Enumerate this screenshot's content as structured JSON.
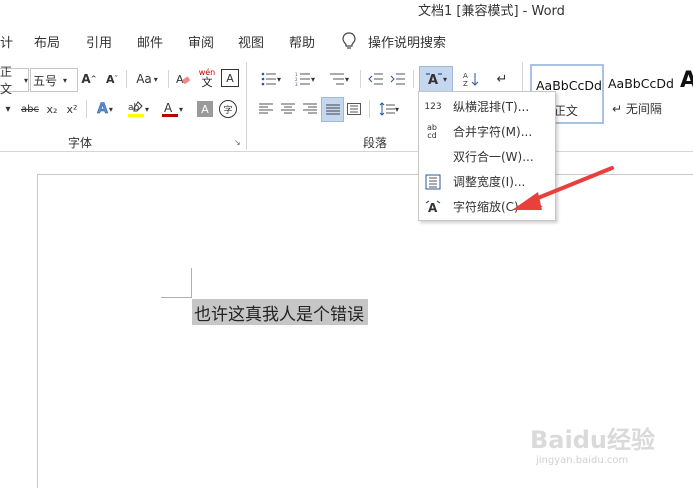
{
  "window": {
    "title": "文档1 [兼容模式]  -  Word"
  },
  "menu": {
    "items": [
      "计",
      "布局",
      "引用",
      "邮件",
      "审阅",
      "视图",
      "帮助"
    ],
    "tell_me": "操作说明搜索"
  },
  "font": {
    "name_partial": "正文",
    "size": "五号",
    "case_label": "Aa",
    "pinyin_top": "wén",
    "pinyin_char": "文",
    "border_char": "A",
    "strike_label": "abc",
    "sub_label": "x₂",
    "sup_label": "x²",
    "char_shading": "A",
    "enclose_char": "字",
    "group_label": "字体"
  },
  "paragraph": {
    "group_label": "段落"
  },
  "styles": [
    {
      "sample": "AaBbCcDd",
      "name": "正文",
      "prefix": "↵"
    },
    {
      "sample": "AaBbCcDd",
      "name": "无间隔",
      "prefix": "↵"
    },
    {
      "sample": "A"
    }
  ],
  "dropdown": {
    "items": [
      {
        "label": "纵横混排(T)...",
        "icon": "vertical-text-icon",
        "icon_text": "123"
      },
      {
        "label": "合并字符(M)...",
        "icon": "combine-chars-icon",
        "icon_text": "ab cd"
      },
      {
        "label": "双行合一(W)...",
        "icon": "two-lines-icon",
        "icon_text": ""
      },
      {
        "label": "调整宽度(I)...",
        "icon": "fit-width-icon",
        "icon_text": ""
      },
      {
        "label": "字符缩放(C)",
        "icon": "char-scale-icon",
        "icon_text": ""
      }
    ]
  },
  "document": {
    "selected_text": "也许这真我人是个错误"
  },
  "watermark": {
    "brand": "Baidu经验",
    "url": "jingyan.baidu.com"
  },
  "colors": {
    "arrow": "#e8403d",
    "highlight": "#ffff00",
    "font_color": "#c00000",
    "selection": "#c6c6c6",
    "accent": "#2b579a"
  }
}
